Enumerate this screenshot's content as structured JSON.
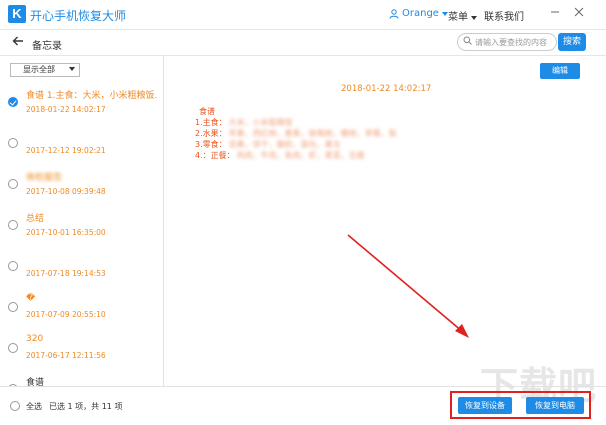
{
  "app": {
    "logo_letter": "K",
    "title": "开心手机恢复大师"
  },
  "titlebar": {
    "user_name": "Orange",
    "menu_label": "菜单",
    "contact_label": "联系我们"
  },
  "header": {
    "title": "备忘录",
    "search_placeholder": "请输入要查找的内容",
    "search_button": "搜索"
  },
  "sidebar": {
    "filter_label": "显示全部",
    "items": [
      {
        "title": "食谱 1.主食：大米，小米粗粮饭...",
        "date": "2018-01-22 14:02:17",
        "checked": true
      },
      {
        "title": "",
        "date": "2017-12-12 19:02:21",
        "checked": false
      },
      {
        "title": "体检报告",
        "date": "2017-10-08 09:39:48",
        "checked": false
      },
      {
        "title": "总结",
        "date": "2017-10-01 16:35:00",
        "checked": false
      },
      {
        "title": "",
        "date": "2017-07-18 19:14:53",
        "checked": false
      },
      {
        "title": "�",
        "date": "2017-07-09 20:55:10",
        "checked": false
      },
      {
        "title": "320",
        "date": "2017-06-17 12:11:56",
        "checked": false
      },
      {
        "title": "食谱",
        "date": "",
        "checked": false
      }
    ]
  },
  "note": {
    "edit_button": "编辑",
    "date": "2018-01-22 14:02:17",
    "heading": "食谱",
    "lines": [
      {
        "label": "1.主食：",
        "content": "大米，小米粗粮饭"
      },
      {
        "label": "2.水果：",
        "content": "苹果，西红柿，香蕉，猕猴桃，樱桃，草莓，梨"
      },
      {
        "label": "3.零食：",
        "content": "坚果，饼干，酸奶，面包，果冻"
      },
      {
        "label": "4.：正餐：",
        "content": "鸡肉，牛肉，鱼肉，虾，青菜，豆腐"
      }
    ]
  },
  "footer": {
    "select_all": "全选",
    "selection_count": "已选 1 项，共 11 项",
    "restore_device": "恢复到设备",
    "restore_pc": "恢复到电脑"
  },
  "watermark": "下载吧",
  "colors": {
    "accent": "#1e8be6",
    "orange": "#f08a24",
    "highlight": "#e12020"
  }
}
